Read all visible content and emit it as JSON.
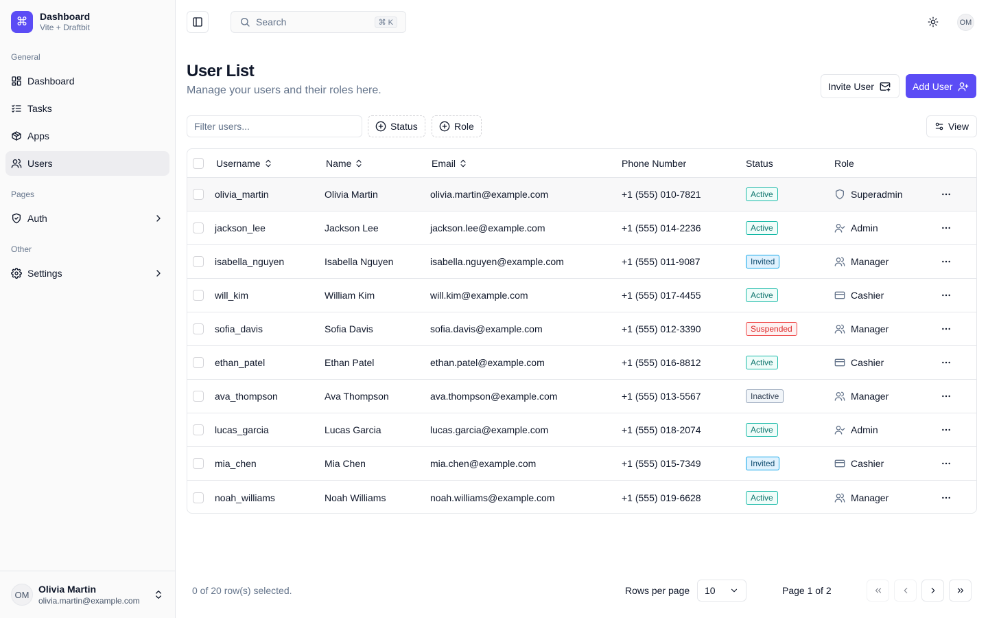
{
  "brand": {
    "title": "Dashboard",
    "subtitle": "Vite + Draftbit",
    "logo": "⌘"
  },
  "nav": {
    "general_label": "General",
    "general": [
      {
        "label": "Dashboard",
        "icon": "grid-icon"
      },
      {
        "label": "Tasks",
        "icon": "list-checks-icon"
      },
      {
        "label": "Apps",
        "icon": "package-icon"
      },
      {
        "label": "Users",
        "icon": "users-icon",
        "active": true
      }
    ],
    "pages_label": "Pages",
    "pages": [
      {
        "label": "Auth",
        "icon": "shield-check-icon"
      }
    ],
    "other_label": "Other",
    "other": [
      {
        "label": "Settings",
        "icon": "gear-icon"
      }
    ]
  },
  "account": {
    "initials": "OM",
    "name": "Olivia Martin",
    "email": "olivia.martin@example.com"
  },
  "topbar": {
    "search_placeholder": "Search",
    "shortcut": "⌘ K",
    "avatar_initials": "OM"
  },
  "header": {
    "title": "User List",
    "subtitle": "Manage your users and their roles here.",
    "invite_label": "Invite User",
    "add_label": "Add User"
  },
  "filters": {
    "placeholder": "Filter users...",
    "status_label": "Status",
    "role_label": "Role",
    "view_label": "View"
  },
  "table": {
    "columns": {
      "username": "Username",
      "name": "Name",
      "email": "Email",
      "phone": "Phone Number",
      "status": "Status",
      "role": "Role"
    },
    "rows": [
      {
        "username": "olivia_martin",
        "name": "Olivia Martin",
        "email": "olivia.martin@example.com",
        "phone": "+1 (555) 010-7821",
        "status": "Active",
        "role": "Superadmin",
        "role_icon": "shield-icon"
      },
      {
        "username": "jackson_lee",
        "name": "Jackson Lee",
        "email": "jackson.lee@example.com",
        "phone": "+1 (555) 014-2236",
        "status": "Active",
        "role": "Admin",
        "role_icon": "user-check-icon"
      },
      {
        "username": "isabella_nguyen",
        "name": "Isabella Nguyen",
        "email": "isabella.nguyen@example.com",
        "phone": "+1 (555) 011-9087",
        "status": "Invited",
        "role": "Manager",
        "role_icon": "users-icon"
      },
      {
        "username": "will_kim",
        "name": "William Kim",
        "email": "will.kim@example.com",
        "phone": "+1 (555) 017-4455",
        "status": "Active",
        "role": "Cashier",
        "role_icon": "credit-card-icon"
      },
      {
        "username": "sofia_davis",
        "name": "Sofia Davis",
        "email": "sofia.davis@example.com",
        "phone": "+1 (555) 012-3390",
        "status": "Suspended",
        "role": "Manager",
        "role_icon": "users-icon"
      },
      {
        "username": "ethan_patel",
        "name": "Ethan Patel",
        "email": "ethan.patel@example.com",
        "phone": "+1 (555) 016-8812",
        "status": "Active",
        "role": "Cashier",
        "role_icon": "credit-card-icon"
      },
      {
        "username": "ava_thompson",
        "name": "Ava Thompson",
        "email": "ava.thompson@example.com",
        "phone": "+1 (555) 013-5567",
        "status": "Inactive",
        "role": "Manager",
        "role_icon": "users-icon"
      },
      {
        "username": "lucas_garcia",
        "name": "Lucas Garcia",
        "email": "lucas.garcia@example.com",
        "phone": "+1 (555) 018-2074",
        "status": "Active",
        "role": "Admin",
        "role_icon": "user-check-icon"
      },
      {
        "username": "mia_chen",
        "name": "Mia Chen",
        "email": "mia.chen@example.com",
        "phone": "+1 (555) 015-7349",
        "status": "Invited",
        "role": "Cashier",
        "role_icon": "credit-card-icon"
      },
      {
        "username": "noah_williams",
        "name": "Noah Williams",
        "email": "noah.williams@example.com",
        "phone": "+1 (555) 019-6628",
        "status": "Active",
        "role": "Manager",
        "role_icon": "users-icon"
      }
    ]
  },
  "status_colors": {
    "Active": {
      "bg": "#f0fdfa",
      "border": "#14b8a6",
      "text": "#0f766e"
    },
    "Invited": {
      "bg": "#e0f2fe",
      "border": "#0ea5e9",
      "text": "#0c4a6e"
    },
    "Suspended": {
      "bg": "#fef2f2",
      "border": "#ef4444",
      "text": "#dc2626"
    },
    "Inactive": {
      "bg": "#f1f5f9",
      "border": "#94a3b8",
      "text": "#334155"
    }
  },
  "pagination": {
    "selected_text": "0 of 20 row(s) selected.",
    "rows_label": "Rows per page",
    "rows_value": "10",
    "page_text": "Page 1 of 2"
  },
  "accent_color": "#5b4cf5"
}
